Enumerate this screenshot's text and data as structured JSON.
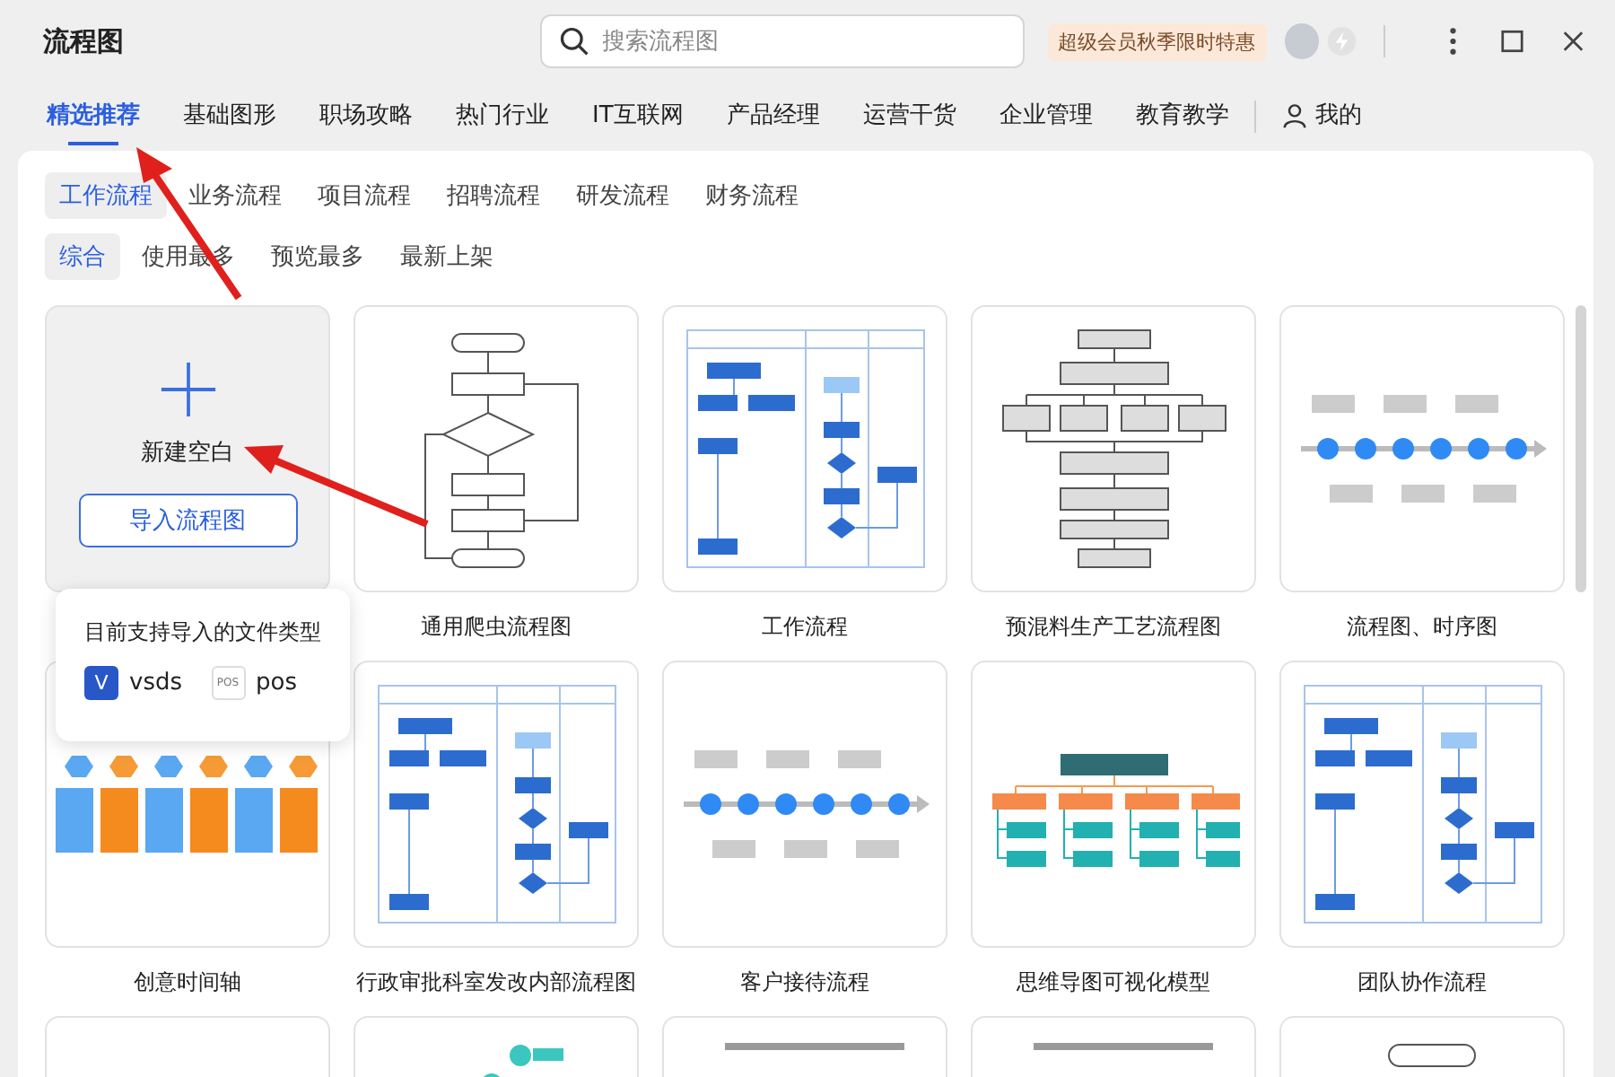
{
  "app_title": "流程图",
  "search": {
    "placeholder": "搜索流程图"
  },
  "promo_badge": "超级会员秋季限时特惠",
  "nav_tabs": [
    {
      "label": "精选推荐",
      "selected": true
    },
    {
      "label": "基础图形",
      "selected": false
    },
    {
      "label": "职场攻略",
      "selected": false
    },
    {
      "label": "热门行业",
      "selected": false
    },
    {
      "label": "IT互联网",
      "selected": false
    },
    {
      "label": "产品经理",
      "selected": false
    },
    {
      "label": "运营干货",
      "selected": false
    },
    {
      "label": "企业管理",
      "selected": false
    },
    {
      "label": "教育教学",
      "selected": false
    }
  ],
  "profile_tab": {
    "label": "我的"
  },
  "category_tabs": [
    {
      "label": "工作流程",
      "selected": true
    },
    {
      "label": "业务流程",
      "selected": false
    },
    {
      "label": "项目流程",
      "selected": false
    },
    {
      "label": "招聘流程",
      "selected": false
    },
    {
      "label": "研发流程",
      "selected": false
    },
    {
      "label": "财务流程",
      "selected": false
    }
  ],
  "sort_tabs": [
    {
      "label": "综合",
      "selected": true
    },
    {
      "label": "使用最多",
      "selected": false
    },
    {
      "label": "预览最多",
      "selected": false
    },
    {
      "label": "最新上架",
      "selected": false
    }
  ],
  "new_blank_card": {
    "label": "新建空白",
    "import_button": "导入流程图"
  },
  "import_popover": {
    "title": "目前支持导入的文件类型",
    "formats": [
      {
        "kind": "vsds",
        "icon_text": "V",
        "label": "vsds"
      },
      {
        "kind": "pos",
        "icon_text": "POS",
        "label": "pos"
      }
    ]
  },
  "templates": [
    {
      "title": "通用爬虫流程图",
      "kind": "flowchart"
    },
    {
      "title": "工作流程",
      "kind": "swimlane"
    },
    {
      "title": "预混料生产工艺流程图",
      "kind": "steps"
    },
    {
      "title": "流程图、时序图",
      "kind": "timeline"
    },
    {
      "title": "创意时间轴",
      "kind": "blocks"
    },
    {
      "title": "行政审批科室发改内部流程图",
      "kind": "swimlane"
    },
    {
      "title": "客户接待流程",
      "kind": "timeline"
    },
    {
      "title": "思维导图可视化模型",
      "kind": "tree"
    },
    {
      "title": "团队协作流程",
      "kind": "swimlane"
    },
    {
      "kind": "blank"
    },
    {
      "kind": "numbered-steps"
    },
    {
      "kind": "document"
    },
    {
      "kind": "document"
    },
    {
      "kind": "terminal"
    }
  ]
}
